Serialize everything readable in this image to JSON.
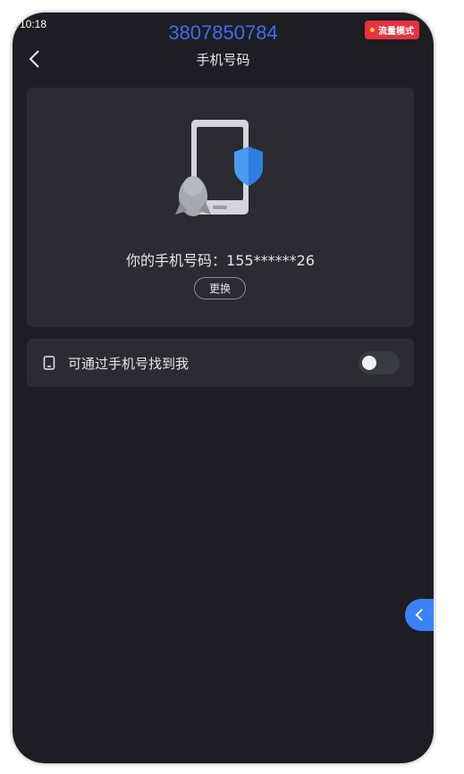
{
  "status_bar": {
    "time": "10:18"
  },
  "overlay": {
    "caller_number": "3807850784",
    "mode_badge": "流量模式"
  },
  "header": {
    "title": "手机号码",
    "back_icon": "chevron-left-icon"
  },
  "phone_card": {
    "illustration": "phone-shield-penguin-illustration",
    "number_text": "你的手机号码：155******26",
    "change_label": "更换"
  },
  "find_me_row": {
    "icon": "phone-icon",
    "label": "可通过手机号找到我",
    "toggle_on": false
  },
  "float_tab": {
    "icon": "chevron-left-icon"
  },
  "colors": {
    "background": "#1e1d23",
    "card": "#2b2b31",
    "accent_blue": "#3b6ff0",
    "badge_red": "#e8323f"
  }
}
